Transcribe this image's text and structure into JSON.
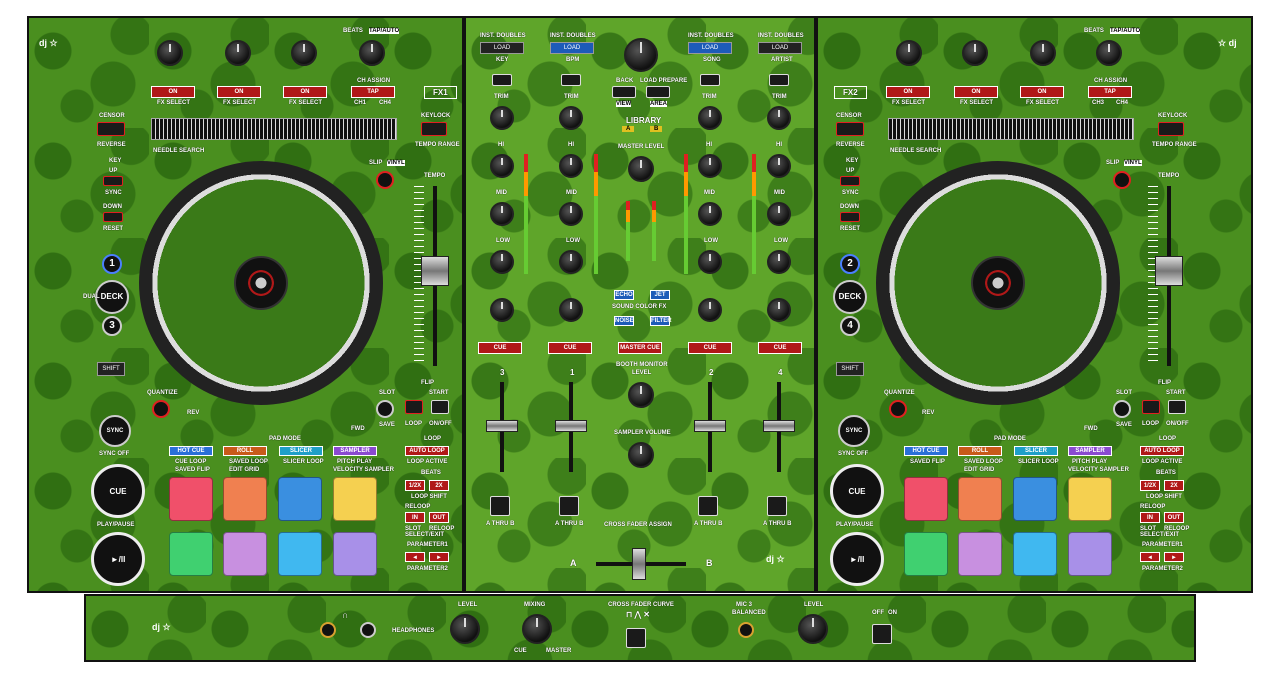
{
  "colors": {
    "panel": "#4a8f1f",
    "accent_red": "#b01818",
    "hot_cue": "#2a6fd8",
    "roll": "#c85a1a",
    "slicer": "#1f9fc8",
    "sampler": "#8a4ad0"
  },
  "deck_left": {
    "fx_buttons": [
      "ON",
      "ON",
      "ON"
    ],
    "fx_select": [
      "FX SELECT",
      "FX SELECT",
      "FX SELECT"
    ],
    "tap": "TAP",
    "beats": "BEATS",
    "tap_auto": "TAP/AUTO",
    "ch_assign": "CH ASSIGN",
    "ch1": "CH1",
    "ch4": "CH4",
    "aux": "AUX",
    "fx_label": "FX1",
    "censor": "CENSOR",
    "reverse": "REVERSE",
    "needle_search": "NEEDLE SEARCH",
    "keylock": "KEYLOCK",
    "tempo_range": "TEMPO RANGE",
    "key": "KEY",
    "up": "UP",
    "sync_small": "SYNC",
    "down": "DOWN",
    "reset": "RESET",
    "slip": "SLIP",
    "vinyl": "VINYL",
    "tempo": "TEMPO",
    "deck": "DECK",
    "deck_nums": [
      "1",
      "3"
    ],
    "dual": "DUAL",
    "shift": "SHIFT",
    "quantize": "QUANTIZE",
    "rev": "REV",
    "fwd": "FWD",
    "slot": "SLOT",
    "save": "SAVE",
    "flip": "FLIP",
    "start": "START",
    "loop": "LOOP",
    "on_off": "ON/OFF",
    "sync": "SYNC",
    "sync_off": "SYNC OFF",
    "cue": "CUE",
    "play_pause": "PLAY/PAUSE",
    "pad_mode": "PAD MODE",
    "modes": [
      "HOT CUE",
      "ROLL",
      "SLICER",
      "SAMPLER"
    ],
    "mode_subs": [
      "CUE LOOP",
      "SAVED LOOP",
      "SLICER LOOP",
      "PITCH PLAY"
    ],
    "mode_subs2": [
      "SAVED FLIP",
      "EDIT GRID",
      "",
      "VELOCITY SAMPLER"
    ],
    "loop_title": "LOOP",
    "auto_loop": "AUTO LOOP",
    "loop_active": "LOOP ACTIVE",
    "beats_label": "BEATS",
    "half": "1/2X",
    "double": "2X",
    "loop_shift": "LOOP SHIFT",
    "reloop": "RELOOP",
    "in": "IN",
    "out": "OUT",
    "slot_select": "SLOT SELECT",
    "reloop_exit": "RELOOP /EXIT",
    "parameter1": "PARAMETER1",
    "parameter2": "PARAMETER2",
    "pad_colors": [
      "#f0506a",
      "#f08050",
      "#3a8fe0",
      "#f5d050",
      "#40d070",
      "#c890e0",
      "#40b8f0",
      "#a890e8"
    ]
  },
  "deck_right": {
    "fx_label": "FX2",
    "ch_assign": "CH ASSIGN",
    "ch3": "CH3",
    "ch4": "CH4",
    "aux": "AUX",
    "deck_nums": [
      "2",
      "4"
    ],
    "pad_colors": [
      "#f0506a",
      "#f08050",
      "#3a8fe0",
      "#f5d050",
      "#40d070",
      "#c890e0",
      "#40b8f0",
      "#a890e8"
    ]
  },
  "mixer": {
    "load": "LOAD",
    "inst_doubles": "INST. DOUBLES",
    "key": "KEY",
    "bpm": "BPM",
    "song": "SONG",
    "artist": "ARTIST",
    "back": "BACK",
    "load_prepare": "LOAD PREPARE",
    "view": "VIEW",
    "area": "AREA",
    "library": "LIBRARY",
    "lib_a": "A",
    "lib_b": "B",
    "trim": "TRIM",
    "hi": "HI",
    "mid": "MID",
    "low": "LOW",
    "master_level": "MASTER LEVEL",
    "sound_color_fx": "SOUND COLOR FX",
    "echo": "ECHO",
    "jet": "JET",
    "noise": "NOISE",
    "filter": "FILTER",
    "cue": "CUE",
    "master_cue": "MASTER CUE",
    "booth_monitor": "BOOTH MONITOR",
    "level": "LEVEL",
    "sampler_volume": "SAMPLER VOLUME",
    "channels": [
      "3",
      "1",
      "2",
      "4"
    ],
    "thru": "A THRU B",
    "cross_fader_assign": "CROSS FADER ASSIGN",
    "side_a": "A",
    "side_b": "B"
  },
  "front": {
    "headphones": "HEADPHONES",
    "level": "LEVEL",
    "mixing": "MIXING",
    "cue": "CUE",
    "master": "MASTER",
    "cross_fader_curve": "CROSS FADER CURVE",
    "mic3": "MIC 3",
    "balanced": "BALANCED",
    "level2": "LEVEL",
    "off": "OFF",
    "on": "ON"
  }
}
